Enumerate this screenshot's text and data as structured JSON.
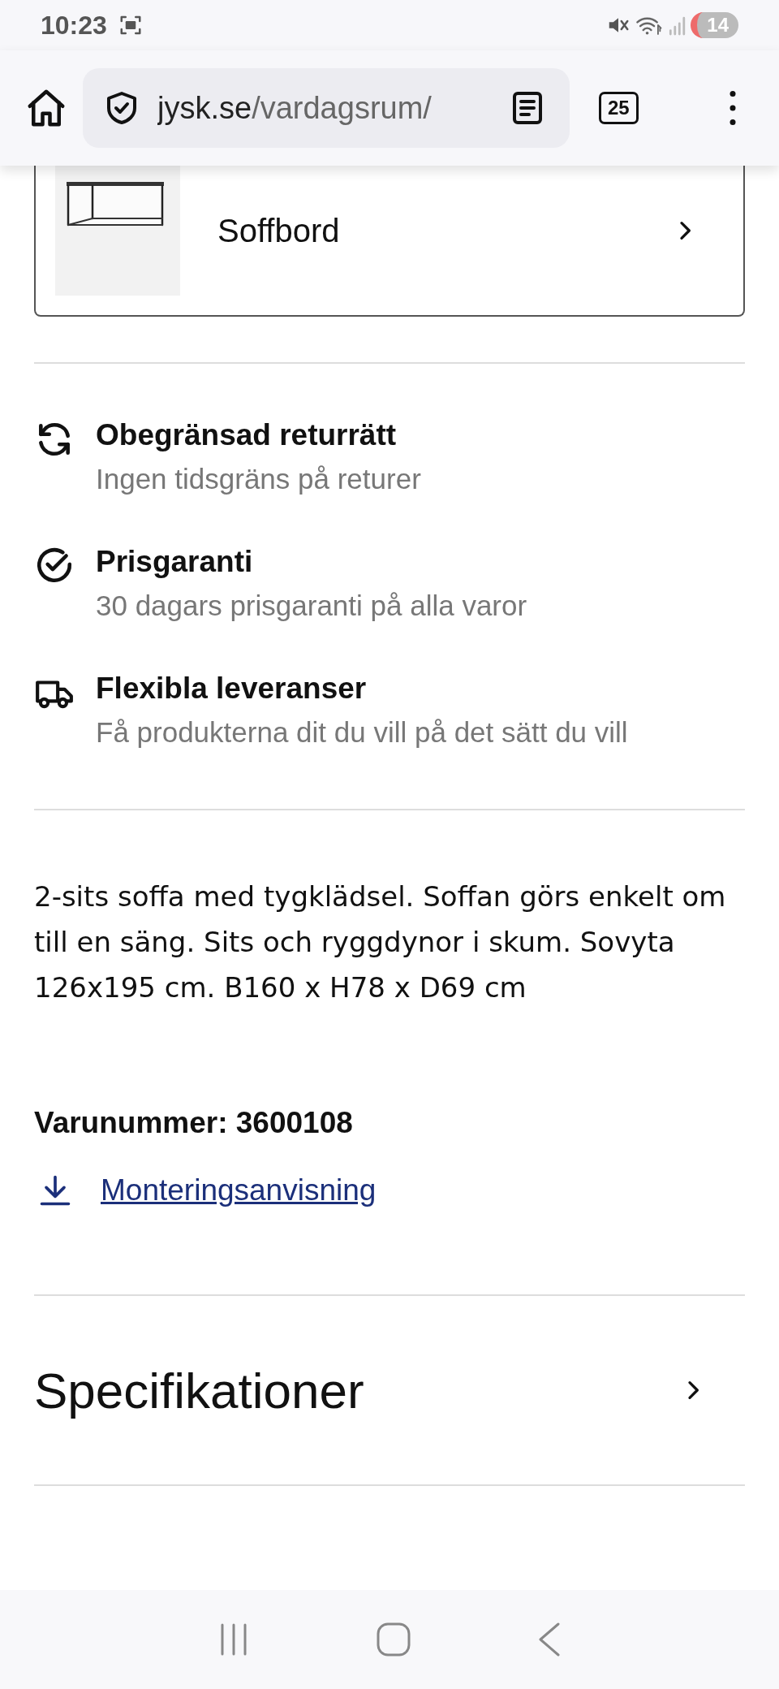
{
  "status_bar": {
    "time": "10:23",
    "notification_count": "14"
  },
  "browser": {
    "url_domain": "jysk.se",
    "url_path": "/vardagsrum/",
    "tab_count": "25"
  },
  "related_card": {
    "label": "Soffbord"
  },
  "features": [
    {
      "kind": "returns",
      "title": "Obegränsad returrätt",
      "subtitle": "Ingen tidsgräns på returer"
    },
    {
      "kind": "guarantee",
      "title": "Prisgaranti",
      "subtitle": "30 dagars prisgaranti på alla varor"
    },
    {
      "kind": "delivery",
      "title": "Flexibla leveranser",
      "subtitle": "Få produkterna dit du vill på det sätt du vill"
    }
  ],
  "description": "2-sits soffa med tygklädsel. Soffan görs enkelt om till en säng. Sits och ryggdynor i skum. Sovyta 126x195 cm. B160 x H78 x D69 cm",
  "item_number": "Varunummer: 3600108",
  "assembly_link": "Monteringsanvisning",
  "sections": [
    {
      "title": "Specifikationer"
    }
  ]
}
